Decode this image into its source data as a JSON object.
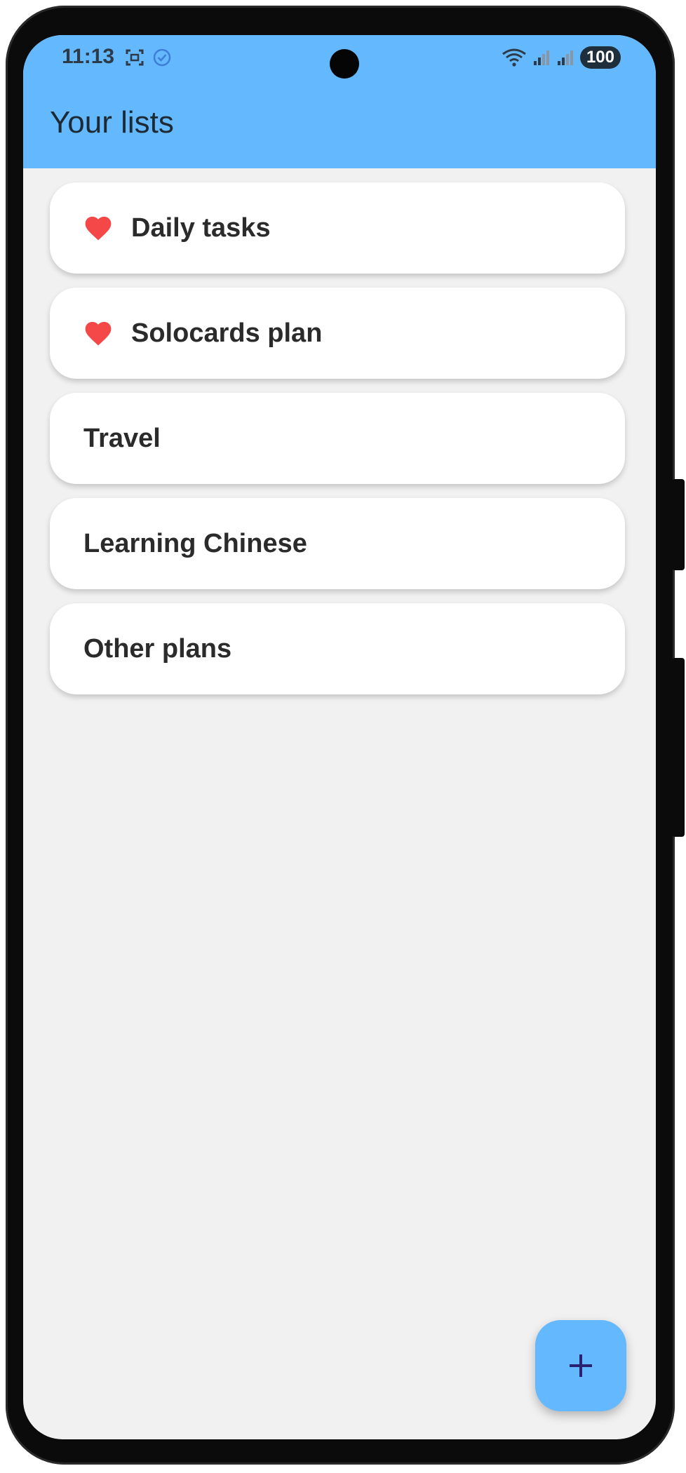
{
  "status_bar": {
    "time": "11:13",
    "battery": "100",
    "icons": [
      "screenshot-icon",
      "check-circle-icon",
      "wifi-icon",
      "signal-icon",
      "signal-icon"
    ]
  },
  "app_bar": {
    "title": "Your lists"
  },
  "lists": [
    {
      "label": "Daily tasks",
      "favorite": true
    },
    {
      "label": "Solocards plan",
      "favorite": true
    },
    {
      "label": "Travel",
      "favorite": false
    },
    {
      "label": "Learning Chinese",
      "favorite": false
    },
    {
      "label": "Other plans",
      "favorite": false
    }
  ],
  "fab": {
    "icon": "plus-icon"
  },
  "colors": {
    "app_bar": "#64b8fe",
    "background": "#f1f1f1",
    "heart": "#f44747",
    "fab_icon": "#2a2170"
  }
}
